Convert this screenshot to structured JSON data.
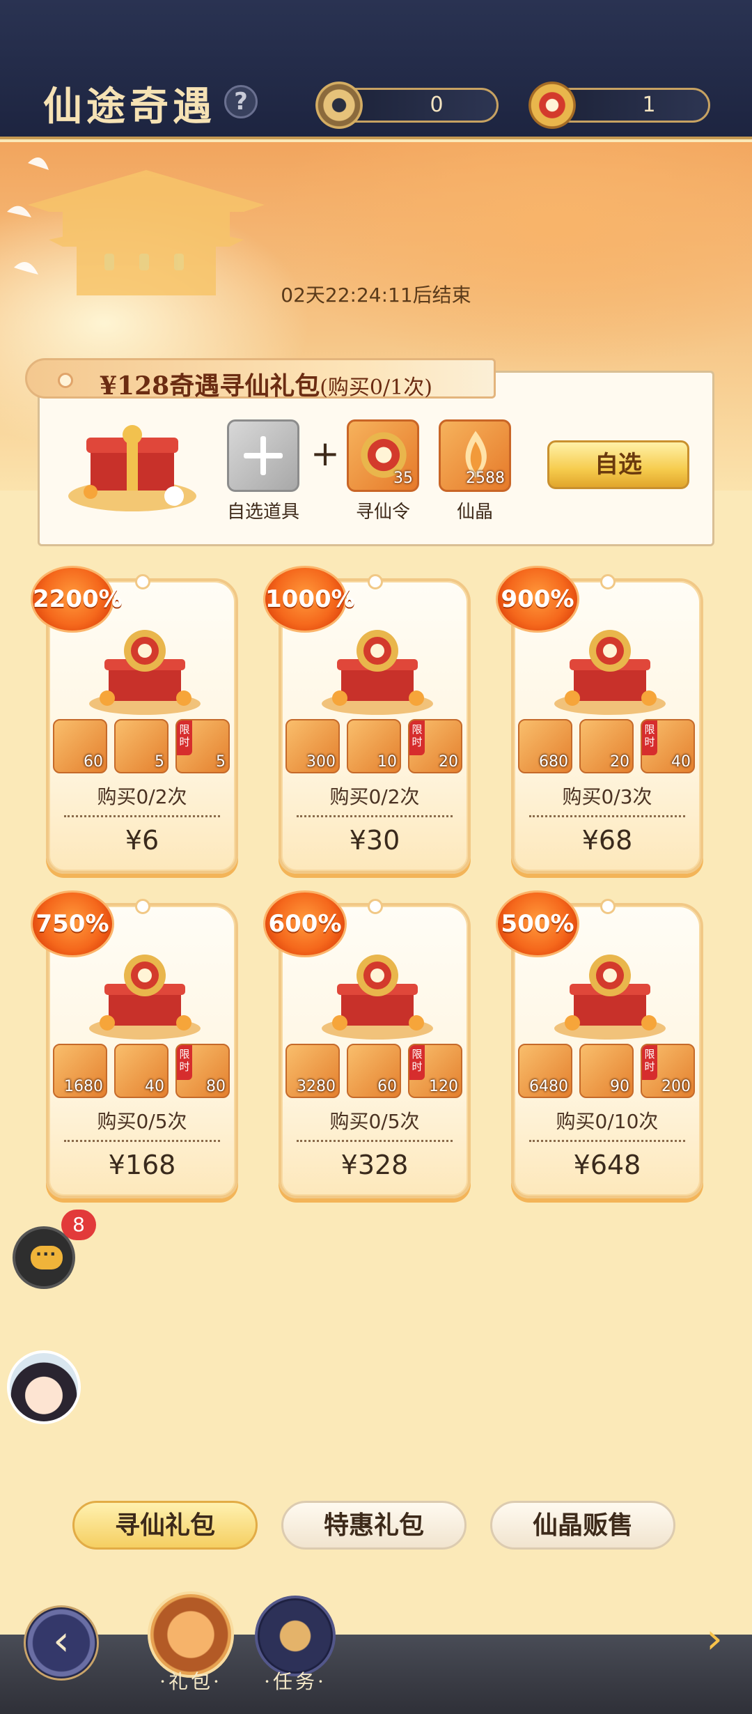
{
  "header": {
    "title": "仙途奇遇",
    "help_icon": "question-mark-icon",
    "currencies": [
      {
        "icon": "xun-xian-coin-icon",
        "value": "0"
      },
      {
        "icon": "xun-xian-ling-icon",
        "value": "1"
      }
    ]
  },
  "event": {
    "countdown": "02天22:24:11后结束"
  },
  "bundle": {
    "title": "¥128奇遇寻仙礼包",
    "limit": "(购买0/1次)",
    "items": [
      {
        "label": "自选道具",
        "count": "",
        "icon": "plus-icon"
      },
      {
        "label": "寻仙令",
        "count": "35",
        "icon": "xun-xian-ling-icon"
      },
      {
        "label": "仙晶",
        "count": "2588",
        "icon": "xian-jing-crystal-icon"
      }
    ],
    "plus": "+",
    "choose_label": "自选"
  },
  "cards": [
    {
      "bonus": "2200%",
      "items": [
        {
          "count": "60"
        },
        {
          "count": "5"
        },
        {
          "count": "5",
          "limited": "限时"
        }
      ],
      "limit": "购买0/2次",
      "price": "¥6"
    },
    {
      "bonus": "1000%",
      "items": [
        {
          "count": "300"
        },
        {
          "count": "10"
        },
        {
          "count": "20",
          "limited": "限时"
        }
      ],
      "limit": "购买0/2次",
      "price": "¥30"
    },
    {
      "bonus": "900%",
      "items": [
        {
          "count": "680"
        },
        {
          "count": "20"
        },
        {
          "count": "40",
          "limited": "限时"
        }
      ],
      "limit": "购买0/3次",
      "price": "¥68"
    },
    {
      "bonus": "750%",
      "items": [
        {
          "count": "1680"
        },
        {
          "count": "40"
        },
        {
          "count": "80",
          "limited": "限时"
        }
      ],
      "limit": "购买0/5次",
      "price": "¥168"
    },
    {
      "bonus": "600%",
      "items": [
        {
          "count": "3280"
        },
        {
          "count": "60"
        },
        {
          "count": "120",
          "limited": "限时"
        }
      ],
      "limit": "购买0/5次",
      "price": "¥328"
    },
    {
      "bonus": "500%",
      "items": [
        {
          "count": "6480"
        },
        {
          "count": "90"
        },
        {
          "count": "200",
          "limited": "限时"
        }
      ],
      "limit": "购买0/10次",
      "price": "¥648"
    }
  ],
  "chat": {
    "badge": "8"
  },
  "tabs": [
    {
      "label": "寻仙礼包",
      "active": true
    },
    {
      "label": "特惠礼包",
      "active": false
    },
    {
      "label": "仙晶贩售",
      "active": false
    }
  ],
  "bottom_nav": {
    "gift_label": "·礼包·",
    "task_label": "·任务·",
    "back_icon": "back-arrow-icon",
    "next_icon": "next-arrow-icon"
  },
  "colors": {
    "header_bg": "#1d2440",
    "badge_orange": "#f5681c",
    "accent_gold": "#f6cc4e"
  }
}
